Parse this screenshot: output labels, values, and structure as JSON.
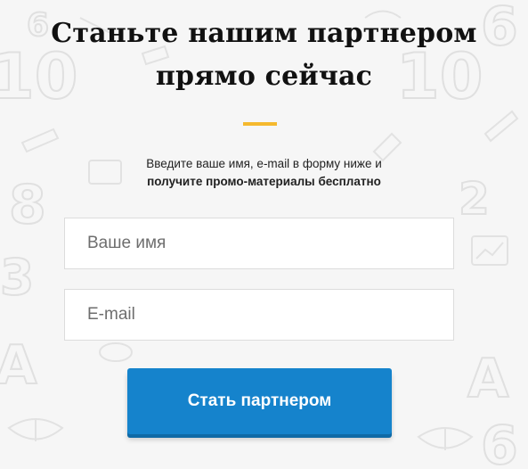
{
  "form": {
    "heading_line1": "Станьте нашим партнером",
    "heading_line2": "прямо сейчас",
    "subtitle_plain": "Введите ваше имя, e-mail в форму ниже и",
    "subtitle_bold": "получите промо-материалы бесплатно",
    "name_placeholder": "Ваше имя",
    "email_placeholder": "E-mail",
    "submit_label": "Стать партнером"
  },
  "colors": {
    "accent": "#f5b92e",
    "button": "#1583cc",
    "background": "#f6f6f6"
  },
  "background_pattern": "school-doodles"
}
